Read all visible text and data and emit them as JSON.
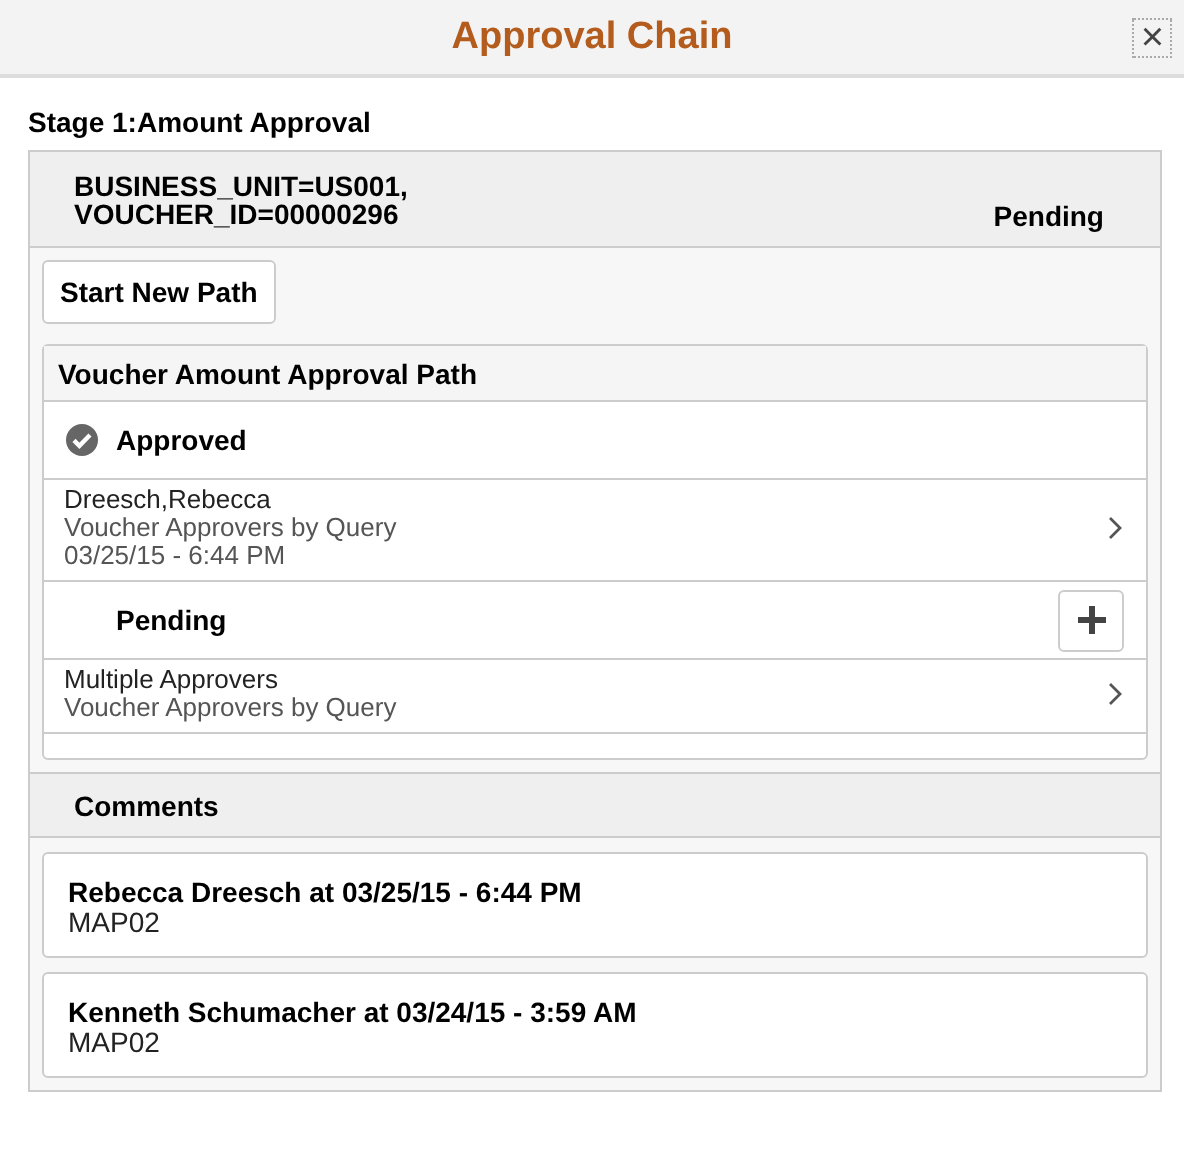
{
  "window": {
    "title": "Approval Chain",
    "close": "×"
  },
  "stage": {
    "label": "Stage 1:Amount Approval",
    "header_lines": [
      "BUSINESS_UNIT=US001,",
      "VOUCHER_ID=00000296"
    ],
    "status": "Pending"
  },
  "start_button": "Start New Path",
  "path": {
    "title": "Voucher Amount Approval Path",
    "steps": [
      {
        "kind": "approved",
        "label": "Approved",
        "rows": [
          {
            "name": "Dreesch,Rebecca",
            "details": [
              "Voucher Approvers by Query",
              "03/25/15 - 6:44 PM"
            ]
          }
        ]
      },
      {
        "kind": "pending",
        "label": "Pending",
        "rows": [
          {
            "name": "Multiple Approvers",
            "details": [
              "Voucher Approvers by Query"
            ]
          }
        ]
      }
    ]
  },
  "comments": {
    "title": "Comments",
    "items": [
      {
        "heading": "Rebecca Dreesch at 03/25/15 - 6:44 PM",
        "text": "MAP02"
      },
      {
        "heading": "Kenneth Schumacher at 03/24/15 - 3:59 AM",
        "text": "MAP02"
      }
    ]
  }
}
